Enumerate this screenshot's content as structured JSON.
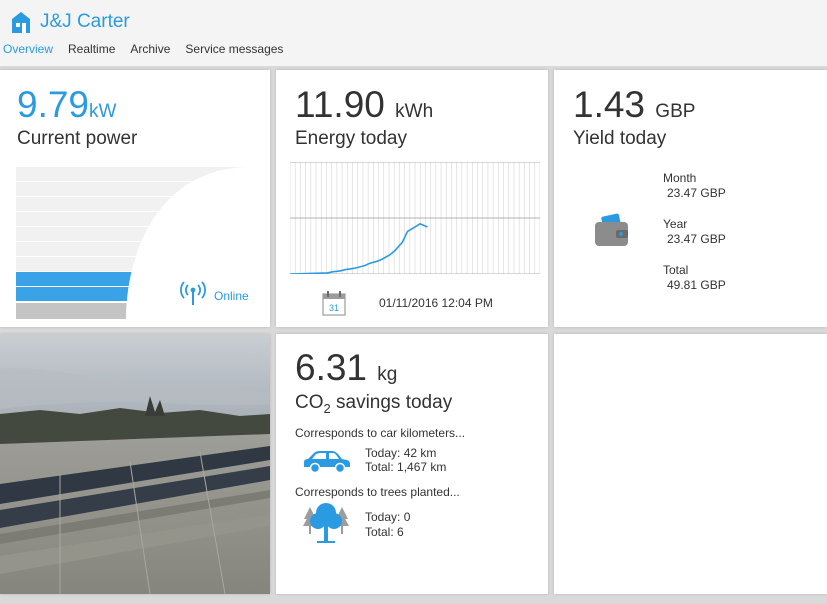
{
  "app": {
    "title": "J&J Carter"
  },
  "nav": {
    "tabs": [
      {
        "label": "Overview",
        "active": true
      },
      {
        "label": "Realtime",
        "active": false
      },
      {
        "label": "Archive",
        "active": false
      },
      {
        "label": "Service messages",
        "active": false
      }
    ]
  },
  "power": {
    "value": "9.79",
    "unit": "kW",
    "label": "Current power",
    "status": "Online",
    "gauge_fill_fraction": 0.35
  },
  "energy": {
    "value": "11.90",
    "unit": "kWh",
    "label": "Energy today",
    "timestamp": "01/11/2016 12:04 PM",
    "calendar_day": "31",
    "chart_data": {
      "type": "line",
      "x": [
        0.0,
        0.15,
        0.17,
        0.2,
        0.22,
        0.25,
        0.27,
        0.3,
        0.32,
        0.35,
        0.37,
        0.4,
        0.42,
        0.45,
        0.47,
        0.5,
        0.52,
        0.55
      ],
      "y": [
        0.0,
        0.05,
        0.1,
        0.14,
        0.19,
        0.24,
        0.29,
        0.38,
        0.48,
        0.57,
        0.67,
        0.86,
        1.05,
        1.43,
        1.9,
        2.1,
        2.24,
        2.1
      ],
      "xlim": [
        0,
        1
      ],
      "ylim": [
        0,
        5
      ],
      "grid": true
    }
  },
  "yield": {
    "value": "1.43",
    "unit": "GBP",
    "label": "Yield today",
    "month_label": "Month",
    "month_value": "23.47 GBP",
    "year_label": "Year",
    "year_value": "23.47 GBP",
    "total_label": "Total",
    "total_value": "49.81 GBP"
  },
  "co2": {
    "value": "6.31",
    "unit": "kg",
    "label_prefix": "CO",
    "label_sub": "2",
    "label_suffix": " savings today",
    "car_text": "Corresponds to car kilometers...",
    "car_today": "Today: 42 km",
    "car_total": "Total: 1,467 km",
    "trees_text": "Corresponds to trees planted...",
    "trees_today": "Today: 0",
    "trees_total": "Total: 6"
  },
  "colors": {
    "accent": "#2a9be0",
    "gauge_blue": "#3aa2e6",
    "gauge_grey": "#c4c4c4"
  }
}
